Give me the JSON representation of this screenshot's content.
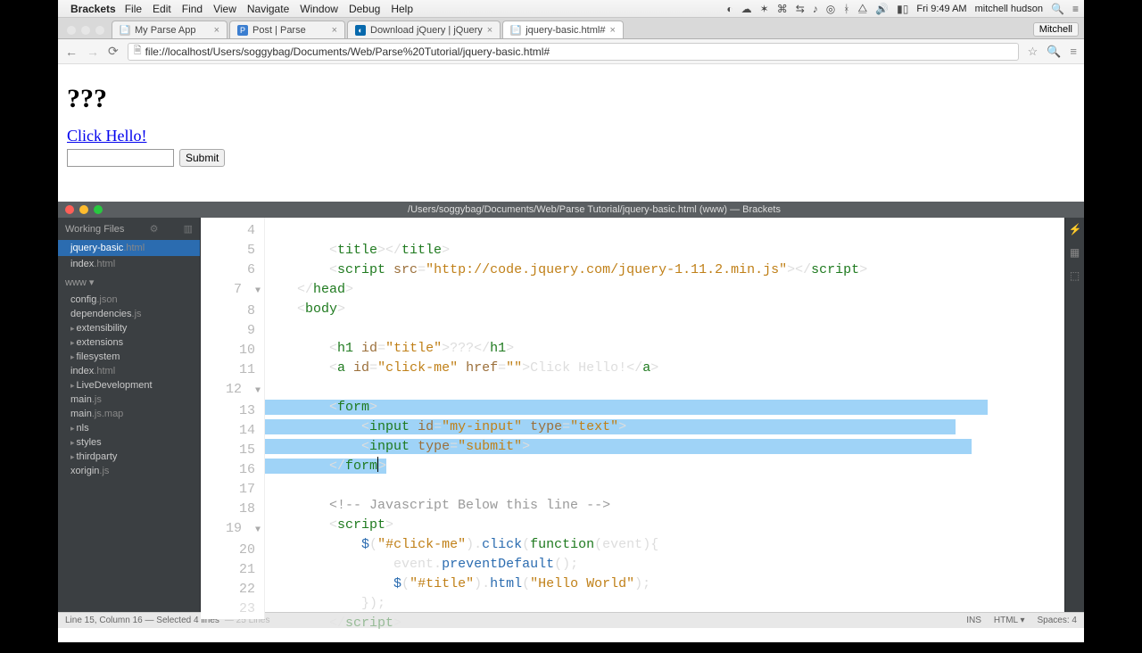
{
  "menubar": {
    "app": "Brackets",
    "items": [
      "File",
      "Edit",
      "Find",
      "View",
      "Navigate",
      "Window",
      "Debug",
      "Help"
    ],
    "clock": "Fri 9:49 AM",
    "user": "mitchell hudson"
  },
  "chrome": {
    "tabs": [
      {
        "label": "My Parse App"
      },
      {
        "label": "Post | Parse"
      },
      {
        "label": "Download jQuery | jQuery"
      },
      {
        "label": "jquery-basic.html#"
      }
    ],
    "profile": "Mitchell",
    "url": "file://localhost/Users/soggybag/Documents/Web/Parse%20Tutorial/jquery-basic.html#"
  },
  "page": {
    "heading": "???",
    "link": "Click Hello!",
    "submit": "Submit"
  },
  "brackets": {
    "title": "/Users/soggybag/Documents/Web/Parse Tutorial/jquery-basic.html (www) — Brackets",
    "working_header": "Working Files",
    "working": [
      {
        "name": "jquery-basic",
        "ext": ".html"
      },
      {
        "name": "index",
        "ext": ".html"
      }
    ],
    "project_label": "www ▾",
    "tree": [
      {
        "t": "f",
        "name": "config",
        "ext": ".json"
      },
      {
        "t": "f",
        "name": "dependencies",
        "ext": ".js"
      },
      {
        "t": "d",
        "name": "extensibility"
      },
      {
        "t": "d",
        "name": "extensions"
      },
      {
        "t": "d",
        "name": "filesystem"
      },
      {
        "t": "f",
        "name": "index",
        "ext": ".html"
      },
      {
        "t": "d",
        "name": "LiveDevelopment"
      },
      {
        "t": "f",
        "name": "main",
        "ext": ".js"
      },
      {
        "t": "f",
        "name": "main",
        "ext": ".js.map"
      },
      {
        "t": "d",
        "name": "nls"
      },
      {
        "t": "d",
        "name": "styles"
      },
      {
        "t": "d",
        "name": "thirdparty"
      },
      {
        "t": "f",
        "name": "xorigin",
        "ext": ".js"
      }
    ],
    "status": {
      "pos": "Line 15, Column 16 — Selected 4 lines",
      "faint": "— 25 Lines",
      "ins": "INS",
      "lang": "HTML ▾",
      "spaces": "Spaces: 4"
    },
    "code": {
      "l4": {
        "tag": "title"
      },
      "l5": {
        "tag": "script",
        "src": "\"http://code.jquery.com/jquery-1.11.2.min.js\""
      },
      "l6": {
        "close": "head"
      },
      "l7": {
        "open": "body"
      },
      "l9": {
        "tag": "h1",
        "id": "\"title\"",
        "text": "???"
      },
      "l10": {
        "tag": "a",
        "id": "\"click-me\"",
        "href": "\"\"",
        "text": "Click Hello!"
      },
      "l12": {
        "open": "form"
      },
      "l13": {
        "tag": "input",
        "id": "\"my-input\"",
        "type": "\"text\""
      },
      "l14": {
        "tag": "input",
        "type": "\"submit\""
      },
      "l15": {
        "close": "form"
      },
      "l17": {
        "comment": "<!-- Javascript Below this line -->"
      },
      "l18": {
        "open": "script"
      },
      "l19": {
        "jq": "$",
        "sel": "\"#click-me\"",
        "fn": "click",
        "arg": "function",
        "param": "event"
      },
      "l20": {
        "obj": "event",
        "m": "preventDefault"
      },
      "l21": {
        "jq": "$",
        "sel": "\"#title\"",
        "m": "html",
        "arg": "\"Hello World\""
      },
      "l22": {
        "close": "});"
      }
    }
  }
}
